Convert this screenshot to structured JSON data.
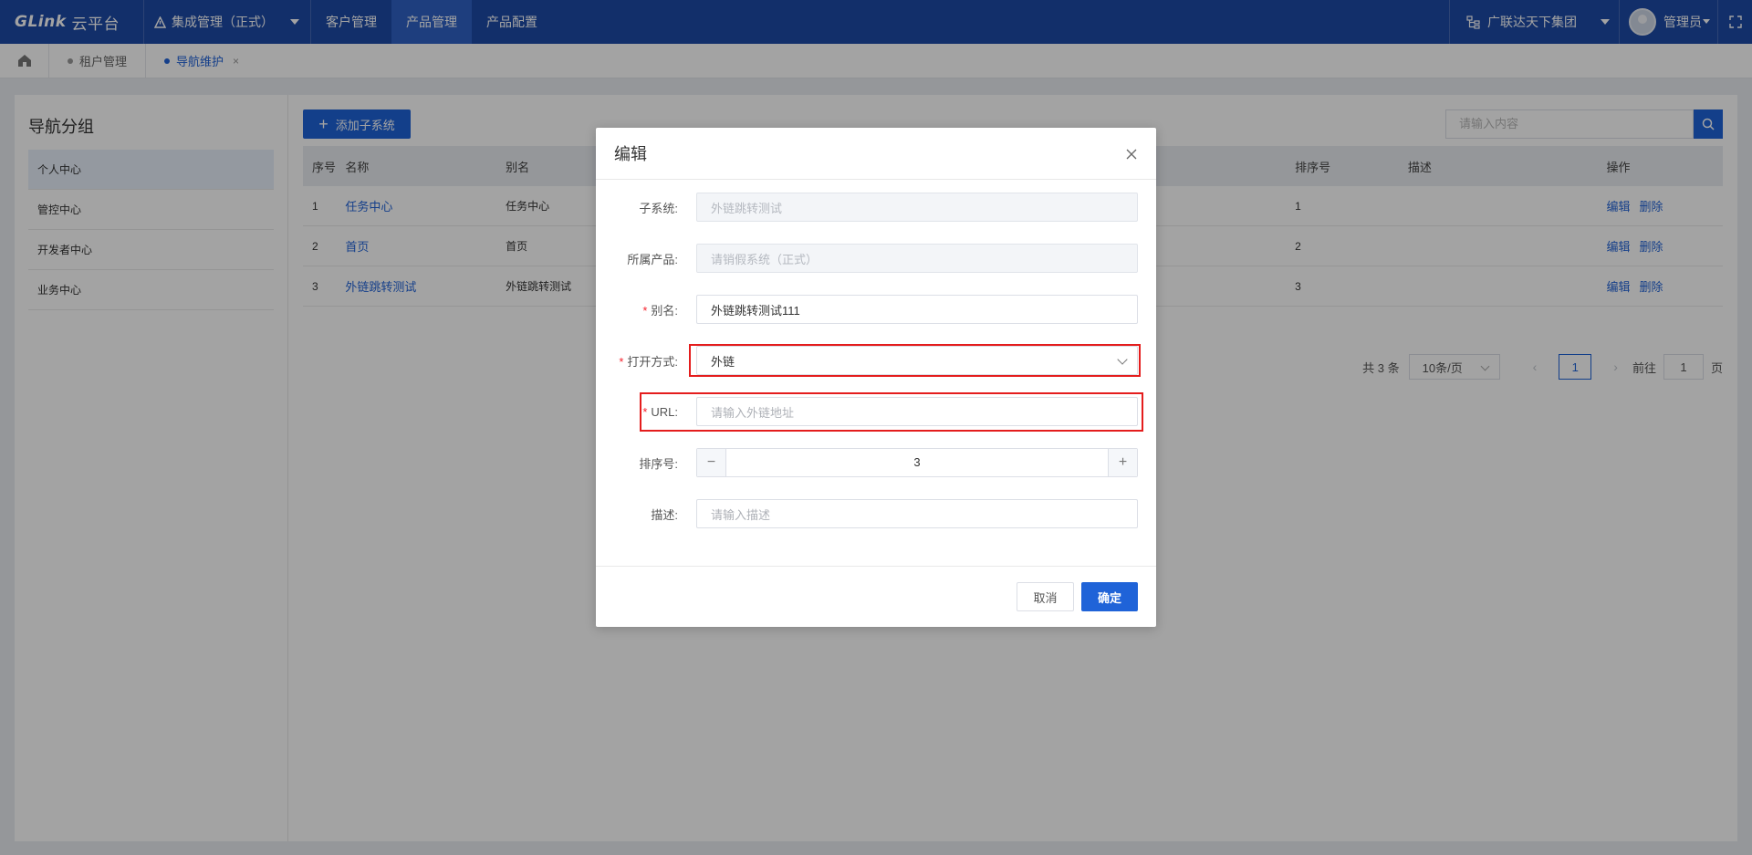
{
  "topbar": {
    "logo_brand": "GLink",
    "logo_sub": "云平台",
    "system_select": "集成管理（正式）",
    "nav": [
      "客户管理",
      "产品管理",
      "产品配置"
    ],
    "active_nav_index": 1,
    "org": "广联达天下集团",
    "user": "管理员"
  },
  "tabs": [
    {
      "label": "租户管理",
      "active": false
    },
    {
      "label": "导航维护",
      "active": true,
      "close": "×"
    }
  ],
  "left_panel": {
    "title": "导航分组",
    "items": [
      "个人中心",
      "管控中心",
      "开发者中心",
      "业务中心"
    ],
    "active_index": 0
  },
  "toolbar": {
    "add_label": "添加子系统",
    "search_placeholder": "请输入内容"
  },
  "table": {
    "headers": {
      "seq": "序号",
      "name": "名称",
      "alias": "别名",
      "order": "排序号",
      "desc": "描述",
      "ops": "操作"
    },
    "rows": [
      {
        "seq": "1",
        "name": "任务中心",
        "alias": "任务中心",
        "order": "1",
        "desc": ""
      },
      {
        "seq": "2",
        "name": "首页",
        "alias": "首页",
        "order": "2",
        "desc": ""
      },
      {
        "seq": "3",
        "name": "外链跳转测试",
        "alias": "外链跳转测试",
        "order": "3",
        "desc": ""
      }
    ],
    "op_edit": "编辑",
    "op_delete": "删除"
  },
  "pager": {
    "total": "共 3 条",
    "page_size": "10条/页",
    "current": "1",
    "goto_prefix": "前往",
    "goto_value": "1",
    "goto_suffix": "页"
  },
  "modal": {
    "title": "编辑",
    "fields": {
      "subsystem_label": "子系统:",
      "subsystem_value": "外链跳转测试",
      "product_label": "所属产品:",
      "product_value": "请销假系统（正式）",
      "alias_label": "别名:",
      "alias_value": "外链跳转测试111",
      "open_label": "打开方式:",
      "open_value": "外链",
      "url_label": "URL:",
      "url_placeholder": "请输入外链地址",
      "order_label": "排序号:",
      "order_value": "3",
      "order_minus": "−",
      "order_plus": "+",
      "desc_label": "描述:",
      "desc_placeholder": "请输入描述"
    },
    "cancel": "取消",
    "ok": "确定"
  },
  "colors": {
    "primary": "#1f63d8",
    "topbar": "#1d4aa6",
    "highlight": "#e41d1d"
  }
}
